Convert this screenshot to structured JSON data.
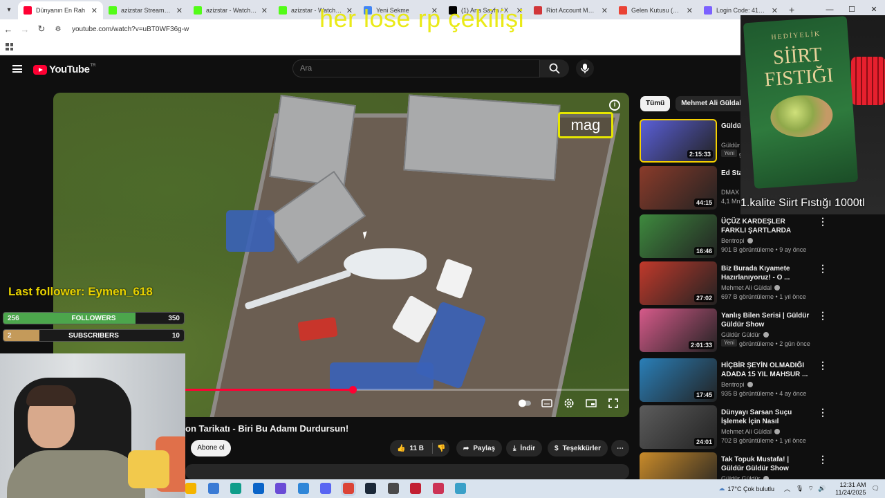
{
  "browser": {
    "tabs": [
      {
        "label": "Dünyanın En Rah",
        "color": "#ff0033",
        "active": true
      },
      {
        "label": "azizstar Stream - Wa",
        "color": "#53fc18"
      },
      {
        "label": "azizstar - Watch clips",
        "color": "#53fc18"
      },
      {
        "label": "azizstar - Watch clips",
        "color": "#53fc18"
      },
      {
        "label": "Yeni Sekme",
        "color": "#4285f4"
      },
      {
        "label": "(1) Ana Sayfa / X",
        "color": "#000000"
      },
      {
        "label": "Riot Account Manag",
        "color": "#d13639"
      },
      {
        "label": "Gelen Kutusu (7.266)",
        "color": "#ea4335"
      },
      {
        "label": "Login Code: 416114",
        "color": "#7b61ff"
      }
    ],
    "new_tab": "+",
    "url": "youtube.com/watch?v=uBT0WF36g-w",
    "controls": {
      "min": "—",
      "max": "☐",
      "close": "✕"
    }
  },
  "overlay": {
    "title": "her lose rp çekilişi",
    "last_follower": "Last follower: Eymen_618",
    "followers": {
      "current": "256",
      "label": "FOLLOWERS",
      "goal": "350",
      "fraction": 0.731
    },
    "subscribers": {
      "current": "2",
      "label": "SUBSCRIBERS",
      "goal": "10",
      "fraction": 0.2
    }
  },
  "youtube": {
    "logo": "YouTube",
    "logo_sup": "TR",
    "search_placeholder": "Ara",
    "video": {
      "channel_watermark": "mag",
      "info": "i",
      "progress": 0.52,
      "title": "on Tarikatı - Biri Bu Adamı Durdursun!"
    },
    "actions": {
      "subscribe": "Abone ol",
      "likes": "11 B",
      "share": "Paylaş",
      "download": "İndir",
      "thanks": "Teşekkürler",
      "more": "⋯"
    },
    "chips": [
      "Tümü",
      "Mehmet Ali Güldal adlı"
    ],
    "recommendations": [
      {
        "title": "Güldür",
        "channel": "Güldür G",
        "meta": "361 B gö",
        "duration": "2:15:33",
        "badge": "Yeni",
        "thumb": "#5a5fd8"
      },
      {
        "title": "Ed Staf Part I",
        "channel": "DMAX T",
        "meta": "4,1 Mn",
        "duration": "44:15",
        "thumb": "#8a3b2a"
      },
      {
        "title": "ÜÇÜZ KARDEŞLER FARKLI ŞARTLARDA BÜYÜRSE NE ...",
        "channel": "Bentropi",
        "meta": "901 B görüntüleme • 9 ay önce",
        "duration": "16:46",
        "thumb": "#3e8a3e"
      },
      {
        "title": "Biz Burada Kıyamete Hazırlanıyoruz! - O ...",
        "channel": "Mehmet Ali Güldal",
        "meta": "697 B görüntüleme • 1 yıl önce",
        "duration": "27:02",
        "thumb": "#c0392b"
      },
      {
        "title": "Yanlış Bilen Serisi | Güldür Güldür Show",
        "channel": "Güldür Güldür",
        "meta": "141 B görüntüleme • 2 gün önce",
        "duration": "2:01:33",
        "badge": "Yeni",
        "thumb": "#d65a8a"
      },
      {
        "title": "HİÇBİR ŞEYİN OLMADIĞI ADADA 15 YIL MAHSUR ...",
        "channel": "Bentropi",
        "meta": "935 B görüntüleme • 4 ay önce",
        "duration": "17:45",
        "thumb": "#2a7fb8"
      },
      {
        "title": "Dünyayı Sarsan Suçu İşlemek İçin Nasıl Kandırıldılar? Kim ...",
        "channel": "Mehmet Ali Güldal",
        "meta": "702 B görüntüleme • 1 yıl önce",
        "duration": "24:01",
        "thumb": "#5c5c5c"
      },
      {
        "title": "Tak Topuk Mustafa! | Güldür Güldür Show",
        "channel": "Güldür Güldür",
        "meta": "",
        "duration": "",
        "thumb": "#c98b2a"
      }
    ]
  },
  "ad": {
    "top": "HEDİYELİK",
    "brand": "SİİRT FISTIĞI",
    "caption": "1.kalite Siirt Fıstığı 1000tl"
  },
  "taskbar": {
    "icons": [
      {
        "name": "file-explorer-icon",
        "color": "#f4b400"
      },
      {
        "name": "copilot-icon",
        "color": "#3a7bd5"
      },
      {
        "name": "edge-icon",
        "color": "#0f9d8a"
      },
      {
        "name": "outlook-icon",
        "color": "#0a64c8"
      },
      {
        "name": "capture-icon",
        "color": "#6a4cd6"
      },
      {
        "name": "store-icon",
        "color": "#2f86d8"
      },
      {
        "name": "discord-icon",
        "color": "#5865f2"
      },
      {
        "name": "chrome-icon",
        "color": "#db4437",
        "active": true
      },
      {
        "name": "steam-icon",
        "color": "#1b2838"
      },
      {
        "name": "wow-icon",
        "color": "#4a4a4a"
      },
      {
        "name": "valorant-icon",
        "color": "#c22033"
      },
      {
        "name": "app-icon",
        "color": "#cc3355"
      },
      {
        "name": "notepad-icon",
        "color": "#3aa0c8"
      }
    ],
    "weather": "17°C  Çok bulutlu",
    "time": "12:31 AM",
    "date": "11/24/2025"
  }
}
